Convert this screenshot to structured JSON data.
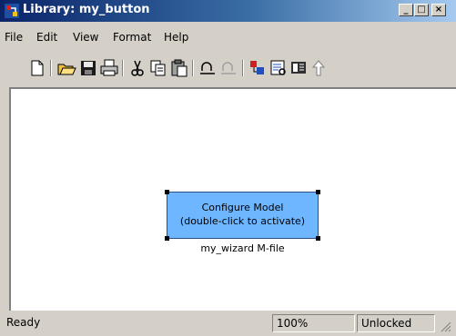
{
  "window": {
    "title": "Library: my_button",
    "minimize_glyph": "_",
    "maximize_glyph": "□",
    "close_glyph": "×"
  },
  "menu": {
    "items": [
      {
        "label": "File"
      },
      {
        "label": "Edit"
      },
      {
        "label": "View"
      },
      {
        "label": "Format"
      },
      {
        "label": "Help"
      }
    ]
  },
  "toolbar": {
    "icons": [
      "new-file-icon",
      "open-folder-icon",
      "save-icon",
      "print-icon",
      "cut-icon",
      "copy-icon",
      "paste-icon",
      "undo-icon",
      "redo-icon",
      "library-browser-icon",
      "model-explorer-icon",
      "debugger-icon",
      "go-to-parent-icon"
    ]
  },
  "block": {
    "line1": "Configure Model",
    "line2": "(double-click to activate)",
    "caption": "my_wizard M-file",
    "color": "#6eb6ff"
  },
  "status": {
    "message": "Ready",
    "zoom": "100%",
    "lock_state": "Unlocked"
  }
}
